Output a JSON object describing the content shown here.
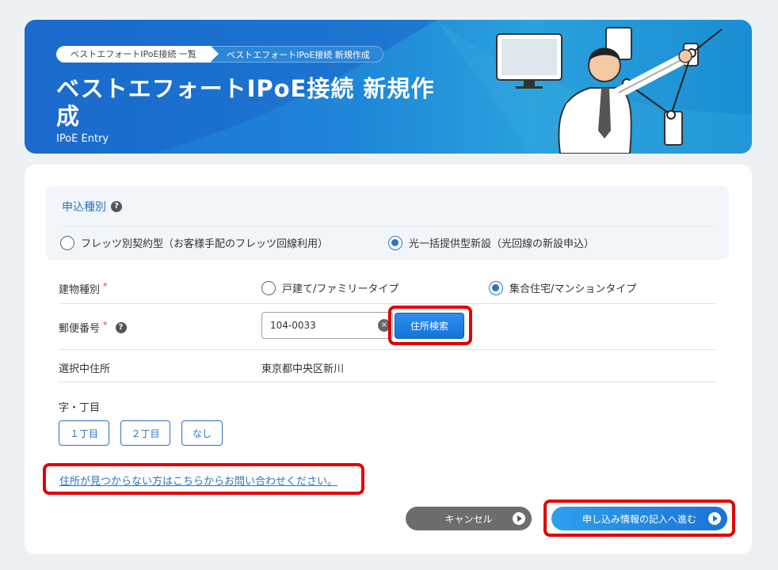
{
  "header": {
    "breadcrumb": [
      "ベストエフォートIPoE接続 一覧",
      "ベストエフォートIPoE接続 新規作成"
    ],
    "title": "ベストエフォートIPoE接続 新規作成",
    "subtitle": "IPoE Entry"
  },
  "apply_type": {
    "label": "申込種別",
    "options": [
      "フレッツ別契約型（お客様手配のフレッツ回線利用）",
      "光一括提供型新設（光回線の新設申込）"
    ],
    "selected_index": 1
  },
  "building_type": {
    "label": "建物種別",
    "required_mark": "*",
    "options": [
      "戸建て/ファミリータイプ",
      "集合住宅/マンションタイプ"
    ],
    "selected_index": 1
  },
  "postal_code": {
    "label": "郵便番号",
    "required_mark": "*",
    "value": "104-0033",
    "search_button": "住所検索"
  },
  "selected_address": {
    "label": "選択中住所",
    "value": "東京都中央区新川"
  },
  "chome": {
    "label": "字・丁目",
    "options": [
      "１丁目",
      "２丁目",
      "なし"
    ]
  },
  "help_link": "住所が見つからない方はこちらからお問い合わせください。",
  "actions": {
    "cancel": "キャンセル",
    "next": "申し込み情報の記入へ進む"
  },
  "colors": {
    "accent": "#2b74bf",
    "highlight": "#e00000",
    "banner": "#1f86d8"
  }
}
